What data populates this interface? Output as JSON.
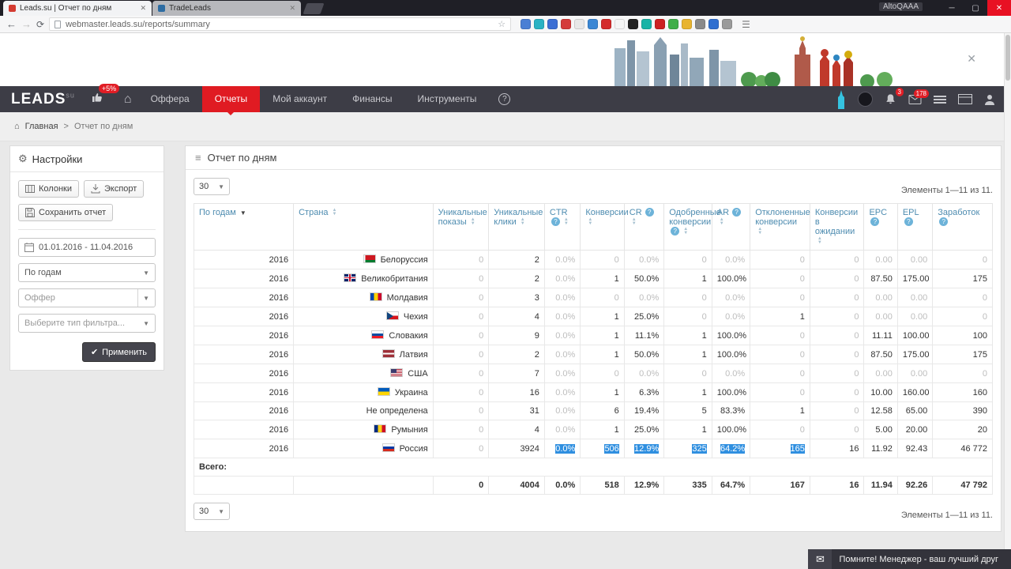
{
  "browser": {
    "tabs": [
      {
        "title": "Leads.su | Отчет по дням",
        "favicon": "#d43b31"
      },
      {
        "title": "TradeLeads",
        "favicon": "#2d6ca2"
      }
    ],
    "overlay_label": "AltoQAAA",
    "url": "webmaster.leads.su/reports/summary",
    "extensions": [
      "#4a7fd4",
      "#2ab2c4",
      "#3b6fd4",
      "#d43b3b",
      "#e8e8e8",
      "#3b87d4",
      "#d42b2b",
      "#f5f5f5",
      "#222222",
      "#18b3a6",
      "#cc2222",
      "#3fae49",
      "#e8b430",
      "#8a8a8a",
      "#2f6fd0",
      "#9a9a9a"
    ]
  },
  "banner": {
    "close_label": "✕"
  },
  "nav": {
    "logo": "LEADS",
    "logo_suffix": "su",
    "likes_badge": "+5%",
    "items": [
      {
        "id": "offers",
        "label": "Оффера",
        "active": false
      },
      {
        "id": "reports",
        "label": "Отчеты",
        "active": true
      },
      {
        "id": "account",
        "label": "Мой аккаунт",
        "active": false
      },
      {
        "id": "finance",
        "label": "Финансы",
        "active": false
      },
      {
        "id": "tools",
        "label": "Инструменты",
        "active": false
      }
    ],
    "help_label": "?",
    "notifications_count": "3",
    "messages_count": "178"
  },
  "breadcrumb": {
    "home": "Главная",
    "separator": ">",
    "current": "Отчет по дням"
  },
  "sidebar": {
    "title": "Настройки",
    "columns_button": "Колонки",
    "export_button": "Экспорт",
    "save_button": "Сохранить отчет",
    "date_range": "01.01.2016 - 11.04.2016",
    "group_select": "По годам",
    "offer_placeholder": "Оффер",
    "filter_select": "Выберите тип фильтра...",
    "apply_button": "Применить"
  },
  "report": {
    "title": "Отчет по дням",
    "page_size": "30",
    "items_info": "Элементы 1—11 из 11.",
    "totals_label": "Всего:"
  },
  "table": {
    "headers": [
      {
        "label": "По годам",
        "sort": "desc",
        "help": false
      },
      {
        "label": "Страна",
        "sort": "both",
        "help": false
      },
      {
        "label": "Уникальные показы",
        "sort": "both",
        "help": false
      },
      {
        "label": "Уникальные клики",
        "sort": "both",
        "help": false
      },
      {
        "label": "CTR",
        "sort": "both",
        "help": true
      },
      {
        "label": "Конверсии",
        "sort": "both",
        "help": false
      },
      {
        "label": "CR",
        "sort": "both",
        "help": true
      },
      {
        "label": "Одобренные конверсии",
        "sort": "both",
        "help": true
      },
      {
        "label": "AR",
        "sort": "both",
        "help": true
      },
      {
        "label": "Отклоненные конверсии",
        "sort": "both",
        "help": false
      },
      {
        "label": "Конверсии в ожидании",
        "sort": "both",
        "help": false
      },
      {
        "label": "EPC",
        "sort": null,
        "help": true
      },
      {
        "label": "EPL",
        "sort": null,
        "help": true
      },
      {
        "label": "Заработок",
        "sort": null,
        "help": true
      }
    ],
    "rows": [
      {
        "year": "2016",
        "flag": "by",
        "country": "Белоруссия",
        "values": [
          "0",
          "2",
          "0.0%",
          "0",
          "0.0%",
          "0",
          "0.0%",
          "0",
          "0",
          "0.00",
          "0.00",
          "0"
        ]
      },
      {
        "year": "2016",
        "flag": "gb",
        "country": "Великобритания",
        "values": [
          "0",
          "2",
          "0.0%",
          "1",
          "50.0%",
          "1",
          "100.0%",
          "0",
          "0",
          "87.50",
          "175.00",
          "175"
        ]
      },
      {
        "year": "2016",
        "flag": "md",
        "country": "Молдавия",
        "values": [
          "0",
          "3",
          "0.0%",
          "0",
          "0.0%",
          "0",
          "0.0%",
          "0",
          "0",
          "0.00",
          "0.00",
          "0"
        ]
      },
      {
        "year": "2016",
        "flag": "cz",
        "country": "Чехия",
        "values": [
          "0",
          "4",
          "0.0%",
          "1",
          "25.0%",
          "0",
          "0.0%",
          "1",
          "0",
          "0.00",
          "0.00",
          "0"
        ]
      },
      {
        "year": "2016",
        "flag": "sk",
        "country": "Словакия",
        "values": [
          "0",
          "9",
          "0.0%",
          "1",
          "11.1%",
          "1",
          "100.0%",
          "0",
          "0",
          "11.11",
          "100.00",
          "100"
        ]
      },
      {
        "year": "2016",
        "flag": "lv",
        "country": "Латвия",
        "values": [
          "0",
          "2",
          "0.0%",
          "1",
          "50.0%",
          "1",
          "100.0%",
          "0",
          "0",
          "87.50",
          "175.00",
          "175"
        ]
      },
      {
        "year": "2016",
        "flag": "us",
        "country": "США",
        "values": [
          "0",
          "7",
          "0.0%",
          "0",
          "0.0%",
          "0",
          "0.0%",
          "0",
          "0",
          "0.00",
          "0.00",
          "0"
        ]
      },
      {
        "year": "2016",
        "flag": "ua",
        "country": "Украина",
        "values": [
          "0",
          "16",
          "0.0%",
          "1",
          "6.3%",
          "1",
          "100.0%",
          "0",
          "0",
          "10.00",
          "160.00",
          "160"
        ]
      },
      {
        "year": "2016",
        "flag": null,
        "country": "Не определена",
        "values": [
          "0",
          "31",
          "0.0%",
          "6",
          "19.4%",
          "5",
          "83.3%",
          "1",
          "0",
          "12.58",
          "65.00",
          "390"
        ]
      },
      {
        "year": "2016",
        "flag": "ro",
        "country": "Румыния",
        "values": [
          "0",
          "4",
          "0.0%",
          "1",
          "25.0%",
          "1",
          "100.0%",
          "0",
          "0",
          "5.00",
          "20.00",
          "20"
        ]
      },
      {
        "year": "2016",
        "flag": "ru",
        "country": "Россия",
        "values": [
          "0",
          "3924",
          "0.0%",
          "506",
          "12.9%",
          "325",
          "64.2%",
          "165",
          "16",
          "11.92",
          "92.43",
          "46 772"
        ],
        "selected": [
          2,
          3,
          4,
          5,
          6,
          7
        ]
      }
    ],
    "totals": [
      "0",
      "4004",
      "0.0%",
      "518",
      "12.9%",
      "335",
      "64.7%",
      "167",
      "16",
      "11.94",
      "92.26",
      "47 792"
    ]
  },
  "tooltip": {
    "text": "Помните! Менеджер - ваш лучший друг"
  }
}
